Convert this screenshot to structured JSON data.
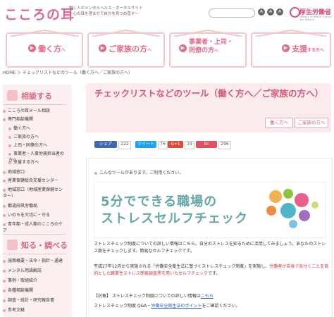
{
  "header": {
    "logo": "こころの耳",
    "tagline_line1": "働く人のメンタルヘルス・ポータルサイト",
    "tagline_line2": "～心の耳を澄ませて自分を見つめ直す～",
    "font_small": "A",
    "font_medium": "A",
    "font_large": "A",
    "ministry": "厚生労働省",
    "ministry_sub": "Ministry of Health, Labour and Welfare"
  },
  "nav": {
    "items": [
      {
        "label": "働く方",
        "suffix": "へ"
      },
      {
        "label": "ご家族の方",
        "suffix": "へ"
      },
      {
        "label": "事業者・上司・",
        "label2": "同僚の方",
        "suffix": "へ"
      },
      {
        "label": "支援",
        "suffix": "する方へ"
      }
    ]
  },
  "breadcrumb": "HOME ＞ チェックリストなどのツール（働く方へ／ご家族の方へ）",
  "sidebar": {
    "section1": "相談する",
    "items1": [
      "こころの耳メール相談",
      "専門相談機関",
      "働く方へ",
      "ご家族の方へ",
      "上司・同僚の方へ",
      "事業者・人事労務担当者の方へ",
      "支援する方へ",
      "地域窓口",
      "産業保健総合支援センター",
      "地域窓口（地域産業保健センター）",
      "都道府県労働局",
      "いのちを大切に・守る",
      "青年期・成人期のこころのケア"
    ],
    "section2": "知る・調べる",
    "items2": [
      "施策概要・法令・指針・通達",
      "メンタル用語解説",
      "事例・取組紹介",
      "各種相談機関",
      "調査・統計・研究報告書",
      "参考文献"
    ]
  },
  "main": {
    "title": "チェックリストなどのツール（働く方へ／ご家族の方へ）",
    "tab1": "働く方へ",
    "tab2": "ご家族の方へ",
    "share": {
      "fb_label": "シェア",
      "fb_count": "222",
      "tw_label": "ツイート",
      "tw_count": "76",
      "g_label": "G+1",
      "g_count": "19",
      "hb_label": "B!",
      "hb_count": "296"
    },
    "intro": "こんなツールがあります。ご利用ください。",
    "banner_line1": "5分でできる職場の",
    "banner_line2": "ストレスセルフチェック",
    "para1": "ストレスチェック制度についての詳しい情報はこちら。自分のストレスを知るために活用してみましょう。あなたのストレス度をチェックします。簡易なセルフチェックです。",
    "para2_a": "平成27年12月から実施される「労働安全衛生法に基づくストレスチェック制度」を実施し、",
    "para2_red": "労働者が自身で気付くことを目的とした職業性ストレス簡易調査票を用いたセルフチェック",
    "para2_b": "です。",
    "para3_a": "【対象】 ストレスチェック制度についての詳しい情報は",
    "para3_link": "こちら",
    "para4_a": "ストレスチェック制度 Q&A・",
    "para4_link": "労働安全衛生法のポイント",
    "para4_b": "をご確認ください。"
  },
  "colors": {
    "brand_pink": "#e0688a",
    "nav_border": "#f4c6c8",
    "title_bg": "#fcebec",
    "banner_teal": "#63a8a6",
    "sidebar_bg": "#fbeff0"
  }
}
